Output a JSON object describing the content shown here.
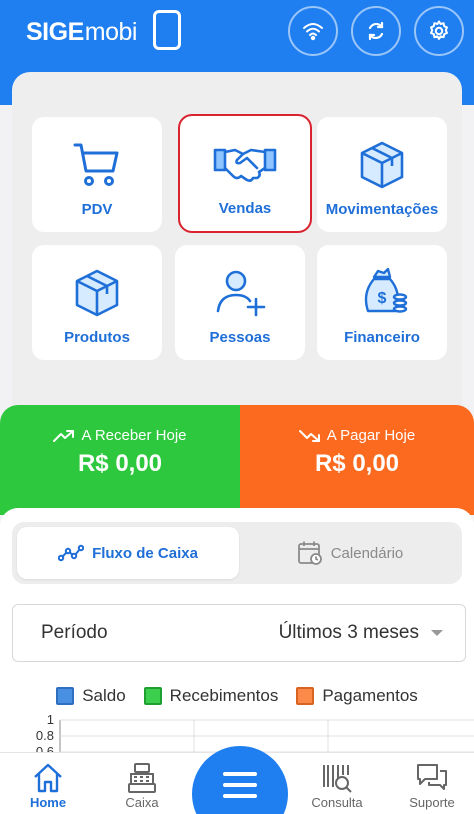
{
  "header": {
    "logo_bold": "SIGE",
    "logo_light": "mobi",
    "buttons": [
      "wifi-icon",
      "sync-icon",
      "settings-icon"
    ]
  },
  "tiles": [
    {
      "label": "PDV",
      "icon": "cart-icon"
    },
    {
      "label": "Vendas",
      "icon": "handshake-icon",
      "selected": true
    },
    {
      "label": "Movimentações",
      "icon": "box-icon"
    },
    {
      "label": "Produtos",
      "icon": "box-icon"
    },
    {
      "label": "Pessoas",
      "icon": "add-person-icon"
    },
    {
      "label": "Financeiro",
      "icon": "money-bag-icon"
    }
  ],
  "summary": {
    "receber_label": "A Receber Hoje",
    "receber_value": "R$ 0,00",
    "pagar_label": "A Pagar Hoje",
    "pagar_value": "R$ 0,00"
  },
  "segments": {
    "active": "Fluxo de Caixa",
    "inactive": "Calendário"
  },
  "filter": {
    "label": "Período",
    "value": "Últimos 3 meses"
  },
  "chart_data": {
    "type": "bar",
    "series": [
      {
        "name": "Saldo",
        "values": []
      },
      {
        "name": "Recebimentos",
        "values": []
      },
      {
        "name": "Pagamentos",
        "values": []
      }
    ],
    "y_ticks": [
      "1",
      "0.8",
      "0.6"
    ]
  },
  "colors": {
    "primary": "#1f7ff0",
    "green": "#2ec83e",
    "orange": "#fb6a1f",
    "legend_saldo": "#4a90e2",
    "legend_recebimentos": "#2ec83e",
    "legend_pagamentos": "#fb8a4a"
  },
  "nav": {
    "home": "Home",
    "caixa": "Caixa",
    "consulta": "Consulta",
    "suporte": "Suporte"
  }
}
